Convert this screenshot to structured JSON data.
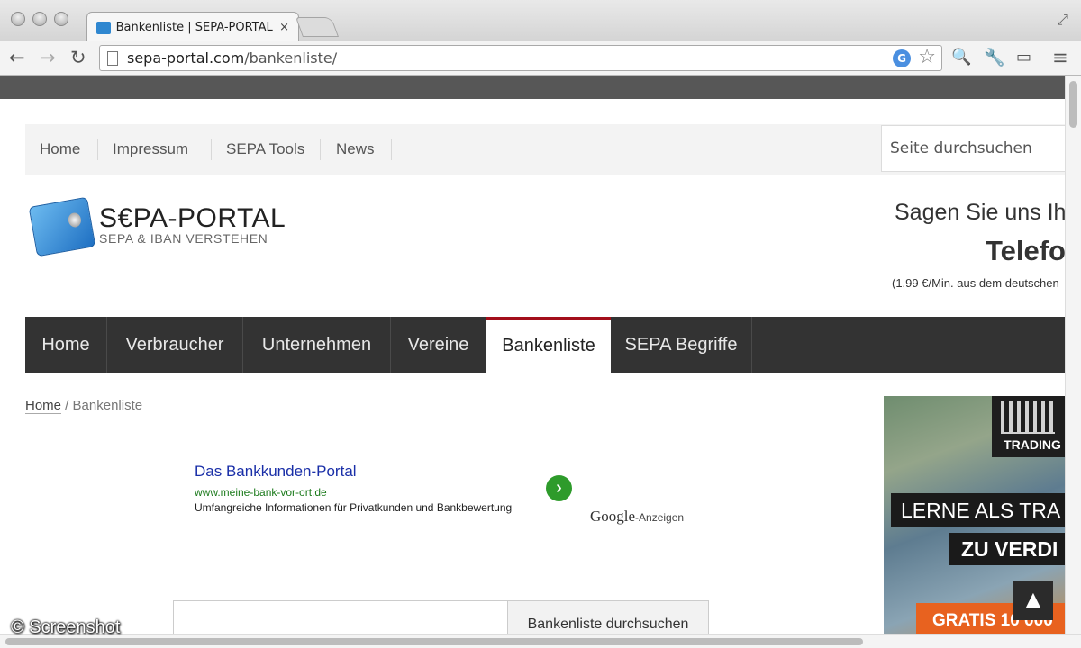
{
  "browser": {
    "tab_title": "Bankenliste | SEPA-PORTAL",
    "tab_close": "×",
    "url_domain": "sepa-portal.com",
    "url_path": "/bankenliste/",
    "back_icon": "arrow-left-icon",
    "forward_icon": "arrow-right-icon",
    "reload_icon": "reload-icon",
    "star_icon": "star-icon"
  },
  "topnav": {
    "items": [
      "Home",
      "Impressum",
      "SEPA Tools",
      "News"
    ],
    "search_placeholder": "Seite durchsuchen"
  },
  "logo": {
    "name": "S€PA-PORTAL",
    "tagline": "SEPA & IBAN VERSTEHEN"
  },
  "promo": {
    "line1": "Sagen Sie uns Ih",
    "line2": "Telefo",
    "line3": "(1.99 €/Min. aus dem deutschen"
  },
  "mainnav": {
    "items": [
      "Home",
      "Verbraucher",
      "Unternehmen",
      "Vereine",
      "Bankenliste",
      "SEPA Begriffe"
    ],
    "active": "Bankenliste"
  },
  "breadcrumb": {
    "home": "Home",
    "separator": " / ",
    "current": "Bankenliste"
  },
  "ad": {
    "title": "Das Bankkunden-Portal",
    "url": "www.meine-bank-vor-ort.de",
    "description": "Umfangreiche Informationen für Privatkunden und Bankbewertung",
    "arrow": "›",
    "google": "Google",
    "anzeigen": "-Anzeigen"
  },
  "bank_search": {
    "button_label": "Bankenliste durchsuchen"
  },
  "banner": {
    "logo_text": "TRADING",
    "line1": "LERNE ALS TRA",
    "line2": "ZU VERDI",
    "line3": "GRATIS 10 000"
  },
  "back_to_top": "▲",
  "watermark": "© Screenshot"
}
